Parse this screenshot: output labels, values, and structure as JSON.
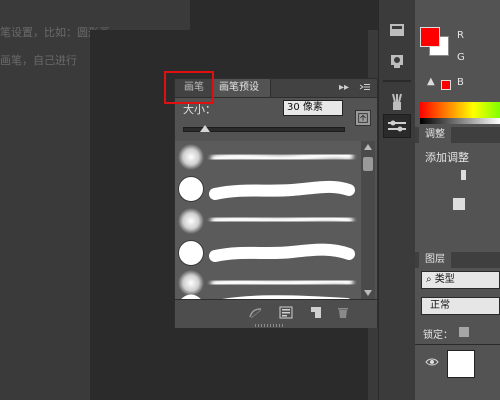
{
  "background": {
    "text_line1": "笔设置，比如：圆形画",
    "text_line2": "画笔，自己进行"
  },
  "brush_panel": {
    "tabs": [
      {
        "label": "画笔",
        "highlighted": true
      },
      {
        "label": "画笔预设",
        "active": true
      }
    ],
    "collapse_glyph": "▸▸",
    "size_label": "大小：",
    "size_value": "30 像素",
    "slider_fraction": 0.14,
    "presets": [
      {
        "type": "soft-round"
      },
      {
        "type": "hard-round"
      },
      {
        "type": "soft-round"
      },
      {
        "type": "hard-round"
      },
      {
        "type": "soft-round"
      },
      {
        "type": "hard-round"
      }
    ]
  },
  "right_panel": {
    "color_label_r": "R",
    "color_label_g": "G",
    "color_label_b": "B",
    "warning_glyph": "▲",
    "adjust_tab": "调整",
    "add_adjust": "添加调整",
    "layers_tab": "图层",
    "layers_kind": "⌕ 类型",
    "blend_mode": "正常",
    "lock_label": "锁定："
  },
  "colors": {
    "foreground": "#ff0000",
    "highlight_box": "#e01010"
  }
}
